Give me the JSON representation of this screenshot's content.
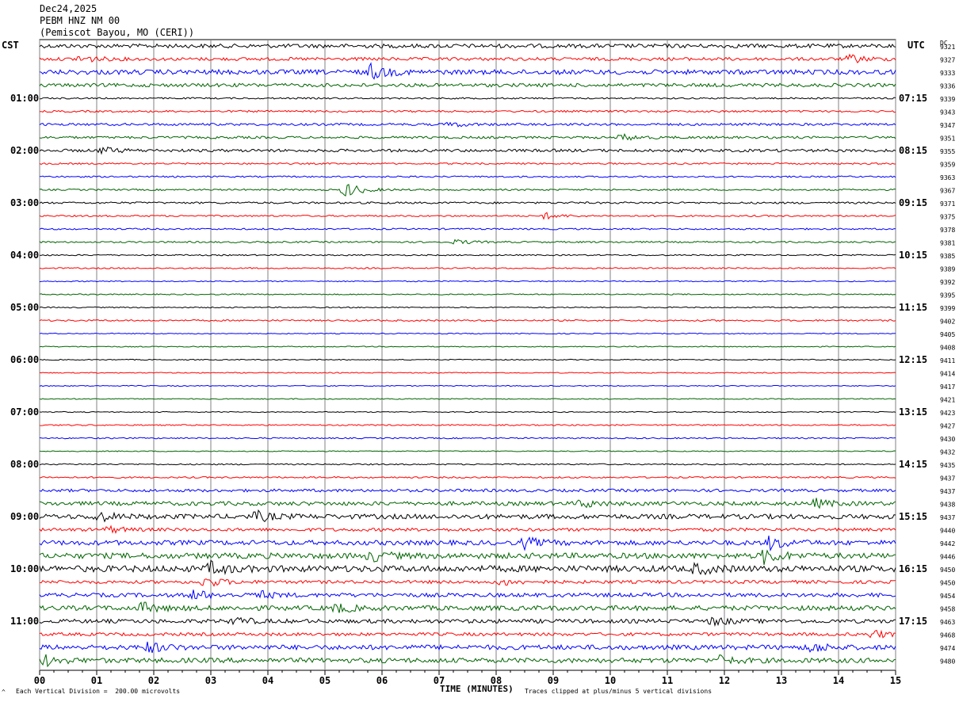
{
  "header": {
    "date": "Dec24,2025",
    "station": "PEBM HNZ NM 00",
    "location": "(Pemiscot Bayou, MO (CERI))"
  },
  "left_zone": "CST",
  "right_zone": "UTC",
  "dc_header": "DC",
  "chart_data": {
    "type": "line",
    "title": "",
    "xlabel": "TIME (MINUTES)",
    "x_ticks": [
      "00",
      "01",
      "02",
      "03",
      "04",
      "05",
      "06",
      "07",
      "08",
      "09",
      "10",
      "11",
      "12",
      "13",
      "14",
      "15"
    ],
    "xlim": [
      0,
      15
    ],
    "left_hour_labels": [
      "01:00",
      "02:00",
      "03:00",
      "04:00",
      "05:00",
      "06:00",
      "07:00",
      "08:00",
      "09:00",
      "10:00",
      "11:00"
    ],
    "right_hour_labels": [
      "07:15",
      "08:15",
      "09:15",
      "10:15",
      "11:15",
      "12:15",
      "13:15",
      "14:15",
      "15:15",
      "16:15",
      "17:15"
    ],
    "trace_colors": [
      "#000000",
      "#ff0000",
      "#0000ff",
      "#006400"
    ],
    "traces": [
      {
        "dc": "9321",
        "amp": 2.5,
        "events": []
      },
      {
        "dc": "9327",
        "amp": 2.0,
        "events": [
          {
            "t": 0.7,
            "a": 5
          },
          {
            "t": 14.2,
            "a": 5
          }
        ]
      },
      {
        "dc": "9333",
        "amp": 3.0,
        "events": [
          {
            "t": 5.8,
            "a": 9
          }
        ]
      },
      {
        "dc": "9336",
        "amp": 2.2,
        "events": []
      },
      {
        "dc": "9339",
        "amp": 1.0,
        "events": []
      },
      {
        "dc": "9343",
        "amp": 1.2,
        "events": []
      },
      {
        "dc": "9347",
        "amp": 1.5,
        "events": [
          {
            "t": 7.2,
            "a": 3
          }
        ]
      },
      {
        "dc": "9351",
        "amp": 1.5,
        "events": [
          {
            "t": 10.2,
            "a": 4
          }
        ]
      },
      {
        "dc": "9355",
        "amp": 1.8,
        "events": [
          {
            "t": 1.1,
            "a": 4
          }
        ]
      },
      {
        "dc": "9359",
        "amp": 1.0,
        "events": []
      },
      {
        "dc": "9363",
        "amp": 1.0,
        "events": []
      },
      {
        "dc": "9367",
        "amp": 1.0,
        "events": [
          {
            "t": 5.35,
            "a": 10
          }
        ]
      },
      {
        "dc": "9371",
        "amp": 1.2,
        "events": []
      },
      {
        "dc": "9375",
        "amp": 1.0,
        "events": [
          {
            "t": 8.85,
            "a": 4
          }
        ]
      },
      {
        "dc": "9378",
        "amp": 1.0,
        "events": []
      },
      {
        "dc": "9381",
        "amp": 1.0,
        "events": [
          {
            "t": 7.3,
            "a": 3
          }
        ]
      },
      {
        "dc": "9385",
        "amp": 0.8,
        "events": []
      },
      {
        "dc": "9389",
        "amp": 0.8,
        "events": []
      },
      {
        "dc": "9392",
        "amp": 0.7,
        "events": []
      },
      {
        "dc": "9395",
        "amp": 0.7,
        "events": []
      },
      {
        "dc": "9399",
        "amp": 0.7,
        "events": []
      },
      {
        "dc": "9402",
        "amp": 1.0,
        "events": []
      },
      {
        "dc": "9405",
        "amp": 0.6,
        "events": []
      },
      {
        "dc": "9408",
        "amp": 0.6,
        "events": []
      },
      {
        "dc": "9411",
        "amp": 0.6,
        "events": []
      },
      {
        "dc": "9414",
        "amp": 0.6,
        "events": []
      },
      {
        "dc": "9417",
        "amp": 0.6,
        "events": []
      },
      {
        "dc": "9421",
        "amp": 0.6,
        "events": []
      },
      {
        "dc": "9423",
        "amp": 0.6,
        "events": []
      },
      {
        "dc": "9427",
        "amp": 0.8,
        "events": []
      },
      {
        "dc": "9430",
        "amp": 0.8,
        "events": []
      },
      {
        "dc": "9432",
        "amp": 0.6,
        "events": []
      },
      {
        "dc": "9435",
        "amp": 0.8,
        "events": []
      },
      {
        "dc": "9437",
        "amp": 1.0,
        "events": []
      },
      {
        "dc": "9437",
        "amp": 1.8,
        "events": []
      },
      {
        "dc": "9438",
        "amp": 2.5,
        "events": [
          {
            "t": 9.5,
            "a": 5
          },
          {
            "t": 13.6,
            "a": 5
          }
        ]
      },
      {
        "dc": "9437",
        "amp": 3.0,
        "events": [
          {
            "t": 1.0,
            "a": 6
          },
          {
            "t": 3.8,
            "a": 6
          }
        ]
      },
      {
        "dc": "9440",
        "amp": 2.0,
        "events": [
          {
            "t": 1.2,
            "a": 4
          }
        ]
      },
      {
        "dc": "9442",
        "amp": 3.0,
        "events": [
          {
            "t": 8.5,
            "a": 6
          },
          {
            "t": 12.8,
            "a": 8
          }
        ]
      },
      {
        "dc": "9446",
        "amp": 3.5,
        "events": [
          {
            "t": 5.8,
            "a": 6
          },
          {
            "t": 12.7,
            "a": 9
          }
        ]
      },
      {
        "dc": "9450",
        "amp": 4.0,
        "events": [
          {
            "t": 3.0,
            "a": 7
          },
          {
            "t": 11.5,
            "a": 6
          }
        ]
      },
      {
        "dc": "9450",
        "amp": 2.0,
        "events": [
          {
            "t": 2.9,
            "a": 7
          },
          {
            "t": 8.1,
            "a": 4
          }
        ]
      },
      {
        "dc": "9454",
        "amp": 2.5,
        "events": [
          {
            "t": 2.7,
            "a": 6
          },
          {
            "t": 3.8,
            "a": 5
          }
        ]
      },
      {
        "dc": "9458",
        "amp": 3.0,
        "events": [
          {
            "t": 1.8,
            "a": 6
          },
          {
            "t": 5.2,
            "a": 5
          }
        ]
      },
      {
        "dc": "9463",
        "amp": 2.5,
        "events": [
          {
            "t": 3.4,
            "a": 5
          },
          {
            "t": 11.8,
            "a": 5
          }
        ]
      },
      {
        "dc": "9468",
        "amp": 2.0,
        "events": [
          {
            "t": 14.6,
            "a": 5
          }
        ]
      },
      {
        "dc": "9474",
        "amp": 3.0,
        "events": [
          {
            "t": 1.9,
            "a": 6
          },
          {
            "t": 13.5,
            "a": 6
          }
        ]
      },
      {
        "dc": "9480",
        "amp": 3.0,
        "events": [
          {
            "t": 0.1,
            "a": 6
          },
          {
            "t": 11.9,
            "a": 5
          }
        ]
      }
    ]
  },
  "footer": {
    "vertical_division": "Each Vertical Division =  200.00 microvolts",
    "clip_note": "Traces clipped at plus/minus 5 vertical divisions",
    "corner_mark": "^"
  }
}
